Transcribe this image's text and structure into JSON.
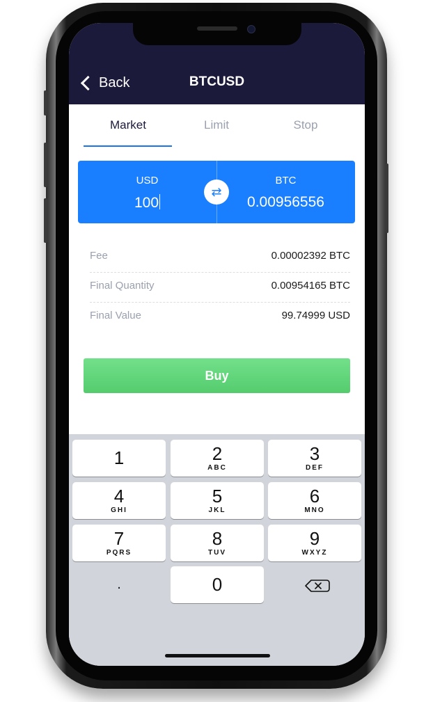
{
  "nav": {
    "back_label": "Back",
    "title": "BTCUSD"
  },
  "tabs": [
    {
      "label": "Market",
      "active": true
    },
    {
      "label": "Limit",
      "active": false
    },
    {
      "label": "Stop",
      "active": false
    }
  ],
  "converter": {
    "from_currency": "USD",
    "from_value": "100",
    "to_currency": "BTC",
    "to_value": "0.00956556",
    "swap_icon": "⇄"
  },
  "details": [
    {
      "label": "Fee",
      "value": "0.00002392 BTC"
    },
    {
      "label": "Final Quantity",
      "value": "0.00954165 BTC"
    },
    {
      "label": "Final Value",
      "value": "99.74999 USD"
    }
  ],
  "buy_label": "Buy",
  "keypad": {
    "keys": [
      {
        "num": "1",
        "letters": ""
      },
      {
        "num": "2",
        "letters": "ABC"
      },
      {
        "num": "3",
        "letters": "DEF"
      },
      {
        "num": "4",
        "letters": "GHI"
      },
      {
        "num": "5",
        "letters": "JKL"
      },
      {
        "num": "6",
        "letters": "MNO"
      },
      {
        "num": "7",
        "letters": "PQRS"
      },
      {
        "num": "8",
        "letters": "TUV"
      },
      {
        "num": "9",
        "letters": "WXYZ"
      },
      {
        "num": "0",
        "letters": ""
      }
    ],
    "dot_label": ".",
    "delete_icon": "backspace-icon"
  },
  "colors": {
    "nav_bg": "#1c1a3a",
    "accent_blue": "#1a7fff",
    "buy_green": "#5fd678",
    "keypad_bg": "#d1d4da"
  }
}
